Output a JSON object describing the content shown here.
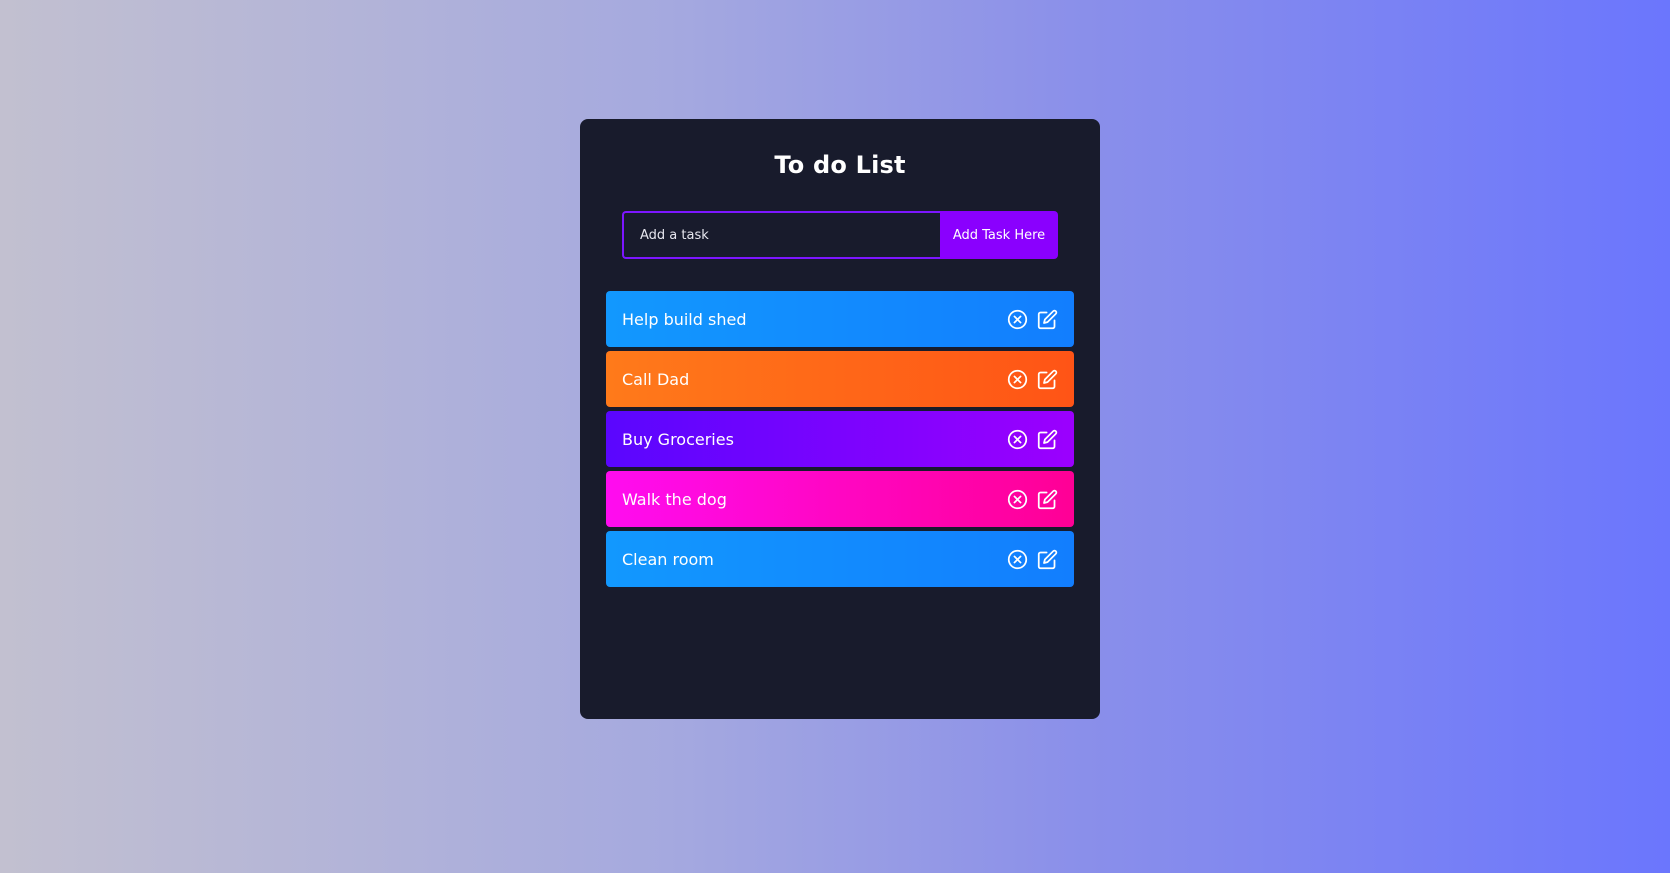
{
  "app": {
    "title": "To do List"
  },
  "form": {
    "input_placeholder": "Add a task",
    "input_value": "",
    "add_button_label": "Add Task Here"
  },
  "todos": [
    {
      "label": "Help build shed",
      "color": "blue"
    },
    {
      "label": "Call Dad",
      "color": "orange"
    },
    {
      "label": "Buy Groceries",
      "color": "purple"
    },
    {
      "label": "Walk the dog",
      "color": "pink"
    },
    {
      "label": "Clean room",
      "color": "blue"
    }
  ],
  "icons": {
    "delete": "close-circle-icon",
    "edit": "edit-icon"
  },
  "colors": {
    "background_left": "#c2c0d0",
    "background_right": "#6b76fd",
    "panel": "#181b2c",
    "accent": "#8a00fe",
    "blue": "#1298fe",
    "orange": "#ff7a1a",
    "purple": "#6a06fe",
    "pink": "#ff0cf0"
  }
}
